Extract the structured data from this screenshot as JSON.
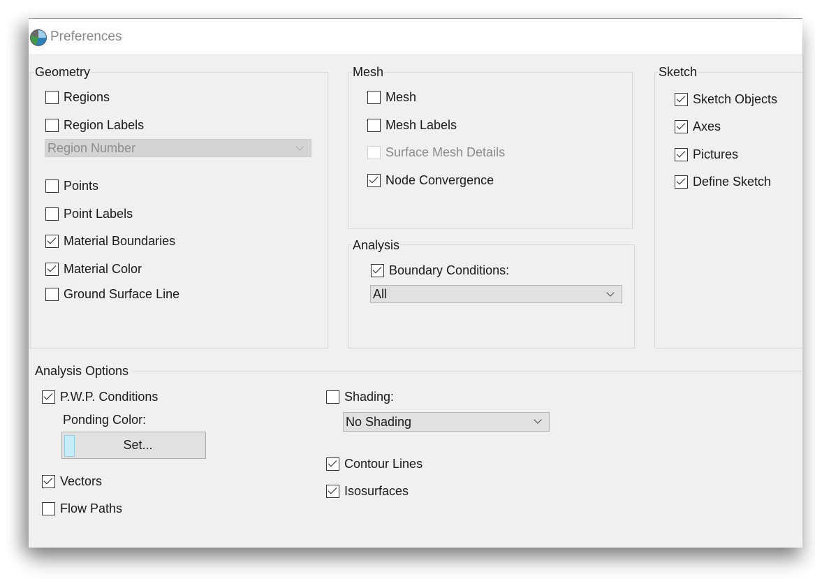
{
  "window": {
    "title": "Preferences",
    "icon": "app-globe-icon"
  },
  "geometry": {
    "label": "Geometry",
    "regions": {
      "label": "Regions",
      "checked": false
    },
    "region_labels": {
      "label": "Region Labels",
      "checked": false
    },
    "region_select": {
      "value": "Region Number",
      "disabled": true
    },
    "points": {
      "label": "Points",
      "checked": false
    },
    "point_labels": {
      "label": "Point Labels",
      "checked": false
    },
    "material_boundaries": {
      "label": "Material Boundaries",
      "checked": true
    },
    "material_color": {
      "label": "Material Color",
      "checked": true
    },
    "ground_surface_line": {
      "label": "Ground Surface Line",
      "checked": false
    }
  },
  "mesh": {
    "label": "Mesh",
    "mesh": {
      "label": "Mesh",
      "checked": false
    },
    "mesh_labels": {
      "label": "Mesh Labels",
      "checked": false
    },
    "surface_mesh_details": {
      "label": "Surface Mesh Details",
      "checked": false,
      "disabled": true
    },
    "node_convergence": {
      "label": "Node Convergence",
      "checked": true
    }
  },
  "analysis": {
    "label": "Analysis",
    "boundary_conditions": {
      "label": "Boundary Conditions:",
      "checked": true
    },
    "boundary_select": {
      "value": "All"
    }
  },
  "sketch": {
    "label": "Sketch",
    "sketch_objects": {
      "label": "Sketch Objects",
      "checked": true
    },
    "axes": {
      "label": "Axes",
      "checked": true
    },
    "pictures": {
      "label": "Pictures",
      "checked": true
    },
    "define_sketch": {
      "label": "Define Sketch",
      "checked": true
    }
  },
  "analysis_options": {
    "label": "Analysis Options",
    "pwp_conditions": {
      "label": "P.W.P. Conditions",
      "checked": true
    },
    "ponding_color_label": "Ponding Color:",
    "ponding_color": "#c6ecfa",
    "set_button": "Set...",
    "vectors": {
      "label": "Vectors",
      "checked": true
    },
    "flow_paths": {
      "label": "Flow Paths",
      "checked": false
    },
    "shading": {
      "label": "Shading:",
      "checked": false
    },
    "shading_select": {
      "value": "No Shading"
    },
    "contour_lines": {
      "label": "Contour Lines",
      "checked": true
    },
    "isosurfaces": {
      "label": "Isosurfaces",
      "checked": true
    }
  }
}
